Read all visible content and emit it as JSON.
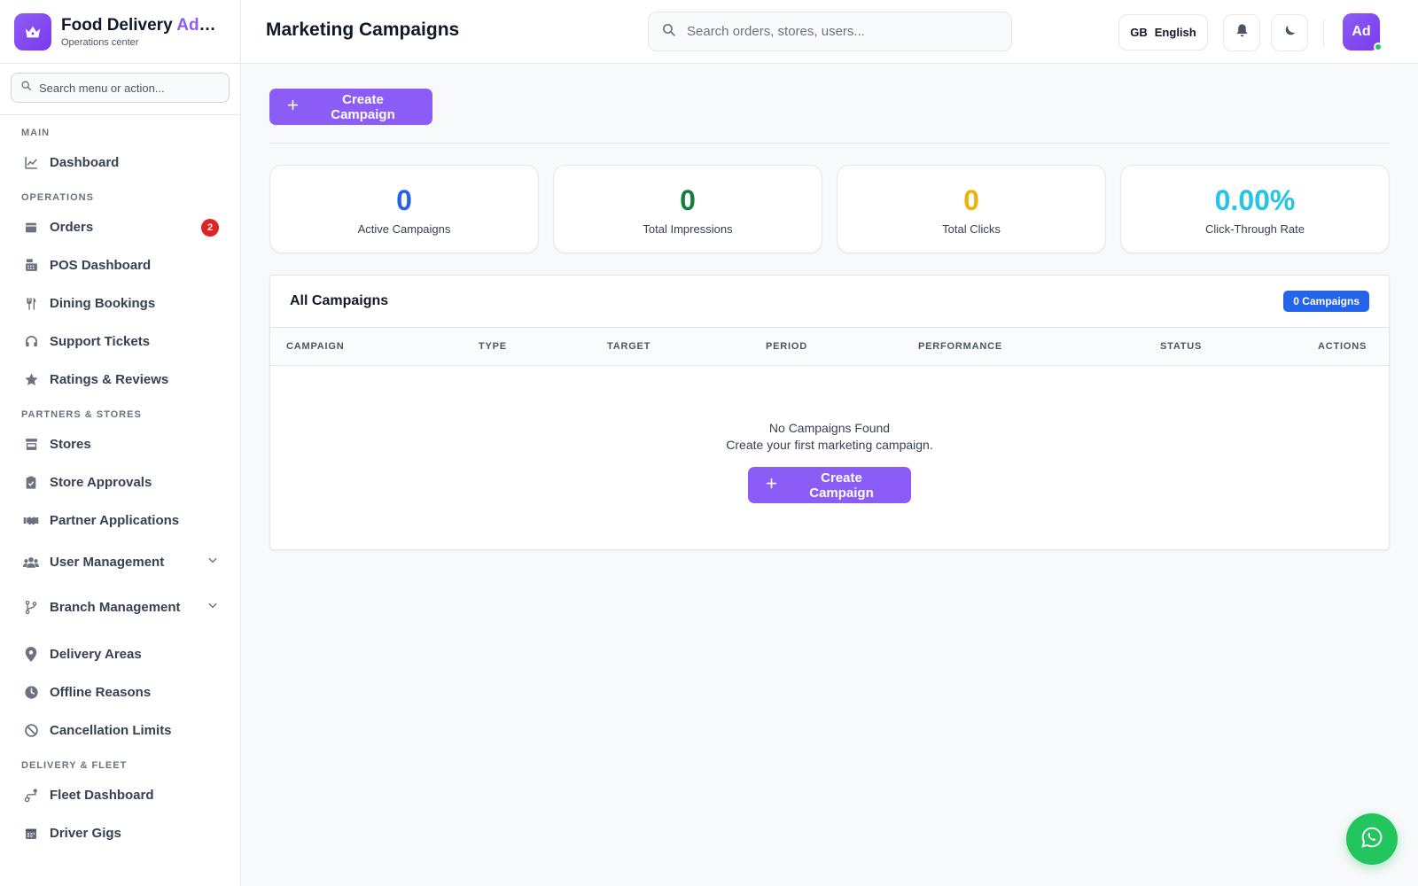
{
  "brand": {
    "title_main": "Food Delivery ",
    "title_accent": "Admin",
    "subtitle": "Operations center"
  },
  "sidebar": {
    "search_placeholder": "Search menu or action...",
    "sections": {
      "main": "MAIN",
      "operations": "OPERATIONS",
      "partners": "PARTNERS & STORES",
      "fleet": "DELIVERY & FLEET"
    },
    "items": {
      "dashboard": "Dashboard",
      "orders": "Orders",
      "orders_badge": "2",
      "pos": "POS Dashboard",
      "dining": "Dining Bookings",
      "support": "Support Tickets",
      "ratings": "Ratings & Reviews",
      "stores": "Stores",
      "store_approvals": "Store Approvals",
      "partner_apps": "Partner Applications",
      "user_mgmt": "User Management",
      "branch_mgmt": "Branch Management",
      "delivery_areas": "Delivery Areas",
      "offline_reasons": "Offline Reasons",
      "cancellation_limits": "Cancellation Limits",
      "fleet_dashboard": "Fleet Dashboard",
      "driver_gigs": "Driver Gigs"
    }
  },
  "header": {
    "title": "Marketing Campaigns",
    "search_placeholder": "Search orders, stores, users...",
    "lang_code": "GB",
    "lang_label": "English",
    "avatar": "Ad"
  },
  "main": {
    "create_label": "Create Campaign",
    "stats": [
      {
        "value": "0",
        "label": "Active Campaigns",
        "color": "#2563eb"
      },
      {
        "value": "0",
        "label": "Total Impressions",
        "color": "#15803d"
      },
      {
        "value": "0",
        "label": "Total Clicks",
        "color": "#eab308"
      },
      {
        "value": "0.00%",
        "label": "Click-Through Rate",
        "color": "#22c5e6"
      }
    ],
    "table": {
      "title": "All Campaigns",
      "count_badge": "0 Campaigns",
      "columns": {
        "campaign": "CAMPAIGN",
        "type": "TYPE",
        "target": "TARGET",
        "period": "PERIOD",
        "performance": "PERFORMANCE",
        "status": "STATUS",
        "actions": "ACTIONS"
      },
      "empty_title": "No Campaigns Found",
      "empty_sub": "Create your first marketing campaign.",
      "empty_button": "Create Campaign"
    }
  },
  "colors": {
    "accent": "#8b5cf6",
    "badge_blue": "#2563eb",
    "whatsapp": "#22c55e"
  }
}
